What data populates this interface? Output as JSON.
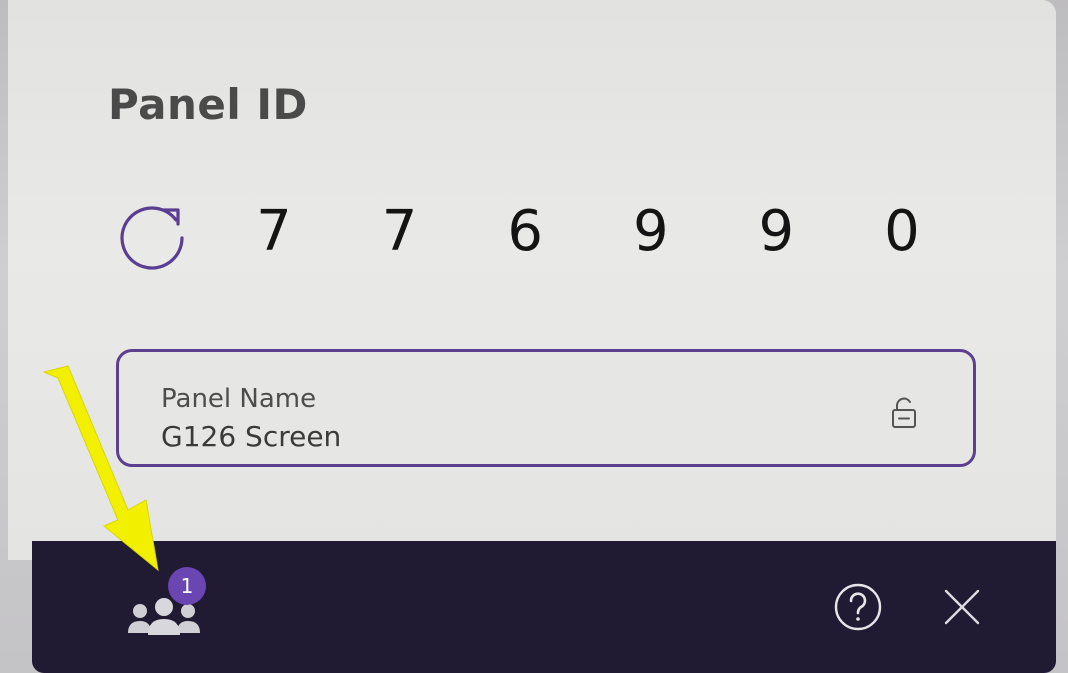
{
  "panel": {
    "title": "Panel ID",
    "digits": [
      "7",
      "7",
      "6",
      "9",
      "9",
      "0"
    ],
    "refresh_icon": "refresh-icon"
  },
  "name_field": {
    "label": "Panel Name",
    "value": "G126 Screen",
    "lock_icon": "unlock-icon"
  },
  "footer": {
    "participants_icon": "participants-icon",
    "participants_count": "1",
    "help_icon": "help-icon",
    "close_icon": "close-icon"
  },
  "colors": {
    "accent": "#6a46b3",
    "border": "#5c3f8e",
    "footer_bg": "#211a33",
    "annotation_arrow": "#f2f000"
  }
}
